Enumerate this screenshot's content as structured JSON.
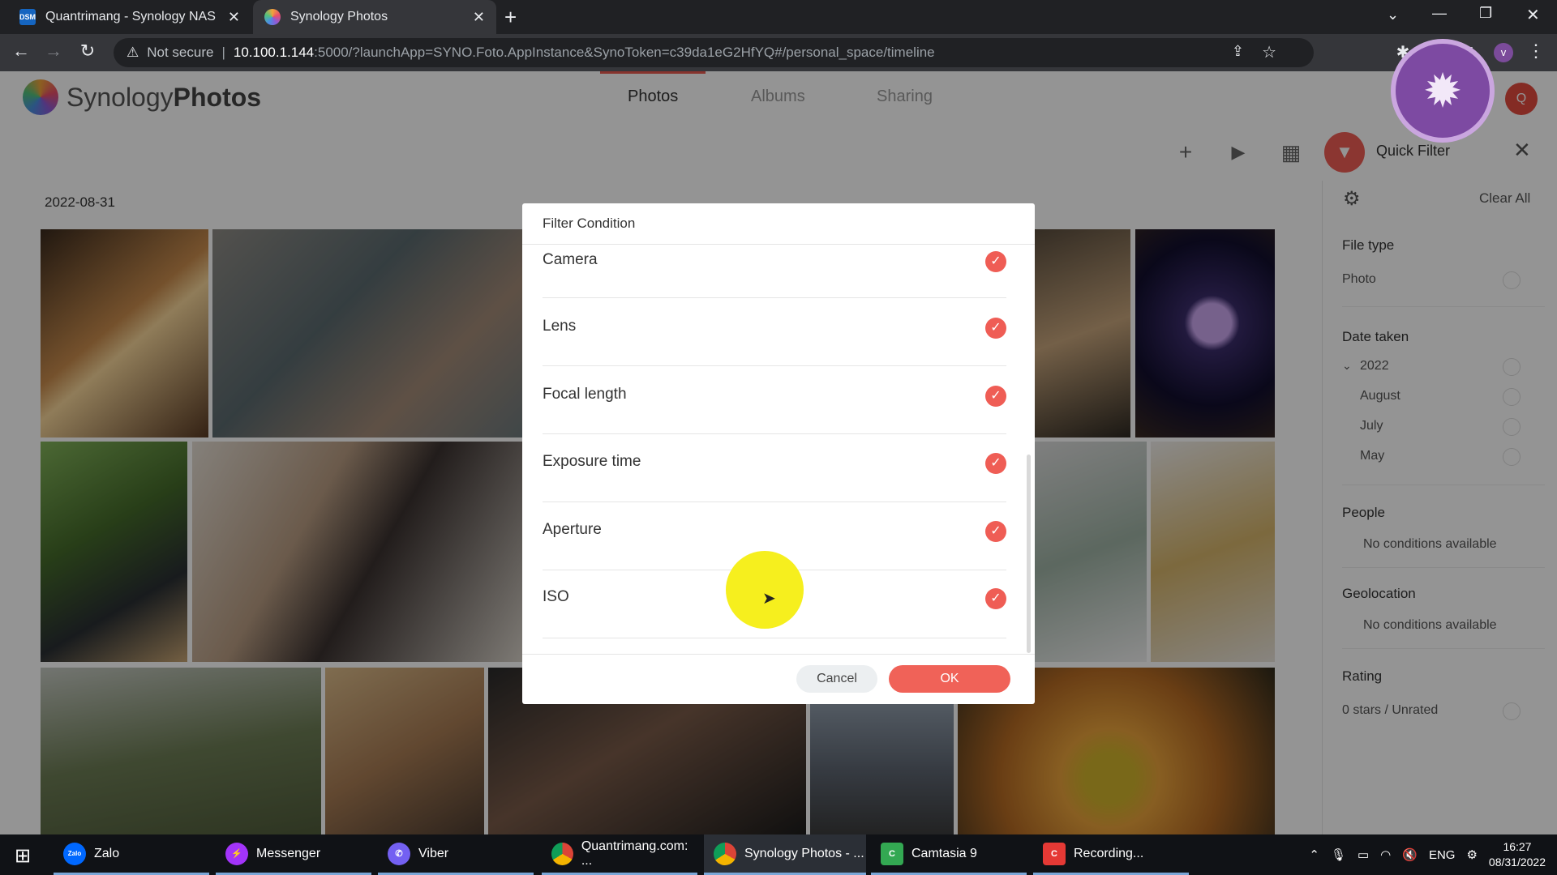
{
  "browser": {
    "tabs": [
      {
        "title": "Quantrimang - Synology NAS",
        "icon": "dsm-icon",
        "icon_text": "DSM"
      },
      {
        "title": "Synology Photos",
        "icon": "synology-photos-icon"
      }
    ],
    "security": "Not secure",
    "url_host": "10.100.1.144",
    "url_rest": ":5000/?launchApp=SYNO.Foto.AppInstance&SynoToken=c39da1eG2HfYQ#/personal_space/timeline",
    "profile_initial": "v"
  },
  "app": {
    "logo_light": "Synology",
    "logo_bold": "Photos",
    "nav": [
      "Photos",
      "Albums",
      "Sharing"
    ],
    "avatar_initial": "Q",
    "date_header": "2022-08-31"
  },
  "filter_panel": {
    "title": "Quick Filter",
    "clear_all": "Clear All",
    "file_type": {
      "heading": "File type",
      "items": [
        "Photo"
      ]
    },
    "date_taken": {
      "heading": "Date taken",
      "year": "2022",
      "months": [
        "August",
        "July",
        "May"
      ]
    },
    "people": {
      "heading": "People",
      "empty": "No conditions available"
    },
    "geolocation": {
      "heading": "Geolocation",
      "empty": "No conditions available"
    },
    "rating": {
      "heading": "Rating",
      "items": [
        "0 stars / Unrated"
      ]
    }
  },
  "dialog": {
    "title": "Filter Condition",
    "options": [
      {
        "label": "Camera",
        "checked": true
      },
      {
        "label": "Lens",
        "checked": true
      },
      {
        "label": "Focal length",
        "checked": true
      },
      {
        "label": "Exposure time",
        "checked": true
      },
      {
        "label": "Aperture",
        "checked": true
      },
      {
        "label": "ISO",
        "checked": true
      }
    ],
    "cancel": "Cancel",
    "ok": "OK"
  },
  "taskbar": {
    "apps": [
      {
        "label": "Zalo",
        "color": "#0068ff",
        "icon_text": "Zalo"
      },
      {
        "label": "Messenger",
        "color": "#a334fa"
      },
      {
        "label": "Viber",
        "color": "#7360f2"
      },
      {
        "label": "Quantrimang.com: ...",
        "color": "#db4437"
      },
      {
        "label": "Synology Photos - ...",
        "color": "#db4437"
      },
      {
        "label": "Camtasia 9",
        "color": "#33a852"
      },
      {
        "label": "Recording...",
        "color": "#e53935"
      }
    ],
    "language": "ENG",
    "time": "16:27",
    "date": "08/31/2022"
  },
  "colors": {
    "accent": "#ef5d55",
    "ok_button": "#f06258",
    "cursor_highlight": "#f6ef1e",
    "overlay_badge": "#7d4aa2"
  }
}
